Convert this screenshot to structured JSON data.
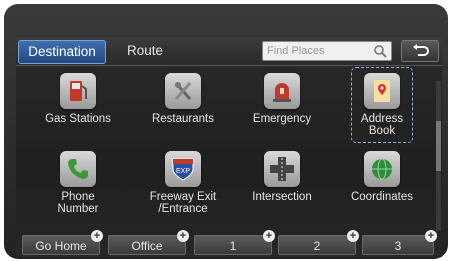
{
  "tabs": {
    "destination": "Destination",
    "route": "Route"
  },
  "search": {
    "placeholder": "Find Places"
  },
  "menu": {
    "gas_stations": "Gas Stations",
    "restaurants": "Restaurants",
    "emergency": "Emergency",
    "address_book_1": "Address",
    "address_book_2": "Book",
    "phone_number_1": "Phone",
    "phone_number_2": "Number",
    "freeway_exit_1": "Freeway Exit",
    "freeway_exit_2": "/Entrance",
    "intersection": "Intersection",
    "coordinates": "Coordinates"
  },
  "freeway_badge": "EXP",
  "bottom": {
    "go_home": "Go Home",
    "office": "Office",
    "slot1": "1",
    "slot2": "2",
    "slot3": "3",
    "plus": "+"
  },
  "colors": {
    "accent": "#3e6fb0",
    "selection": "#8fb0e0"
  }
}
